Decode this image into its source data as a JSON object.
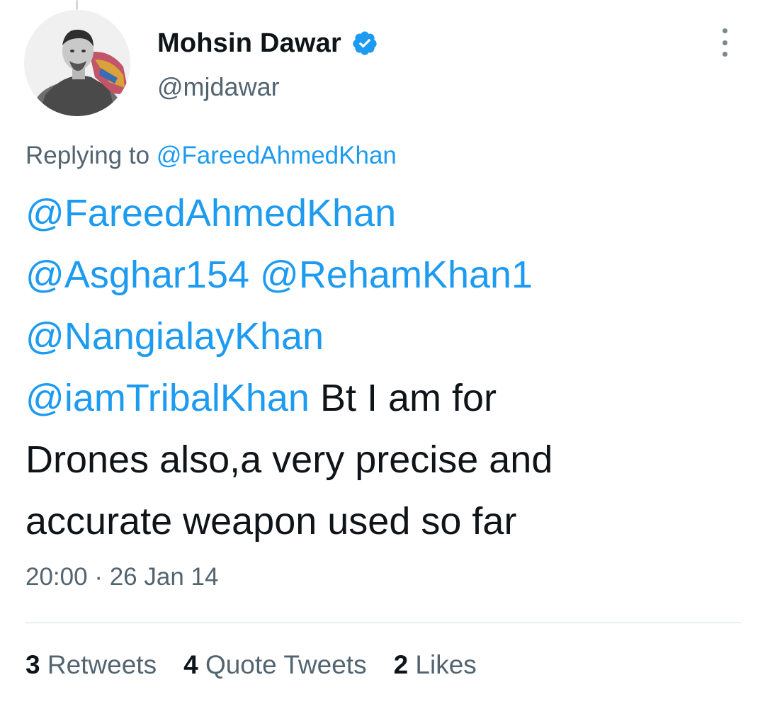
{
  "author": {
    "display_name": "Mohsin Dawar",
    "handle": "@mjdawar",
    "verified": true,
    "avatar_icon": "profile-photo"
  },
  "menu": {
    "icon": "more-vertical-icon"
  },
  "reply_context": {
    "prefix": "Replying to ",
    "target": "@FareedAhmedKhan"
  },
  "tweet": {
    "lines": {
      "l1": "@FareedAhmedKhan",
      "l2a": "@Asghar154",
      "l2b": "@RehamKhan1",
      "l3": "@NangialayKhan",
      "l4_mention": "@iamTribalKhan",
      "l4_text": " Bt I am for",
      "l5": "Drones also,a very precise and",
      "l6": "accurate weapon used so far"
    }
  },
  "timestamp": {
    "time": "20:00",
    "sep": " · ",
    "date": "26 Jan 14"
  },
  "stats": {
    "retweets": {
      "count": "3",
      "label": " Retweets"
    },
    "quotes": {
      "count": "4",
      "label": " Quote Tweets"
    },
    "likes": {
      "count": "2",
      "label": " Likes"
    }
  },
  "colors": {
    "link": "#1d9bf0",
    "secondary_text": "#536471",
    "primary_text": "#0f1419",
    "divider": "#cfd9de"
  }
}
